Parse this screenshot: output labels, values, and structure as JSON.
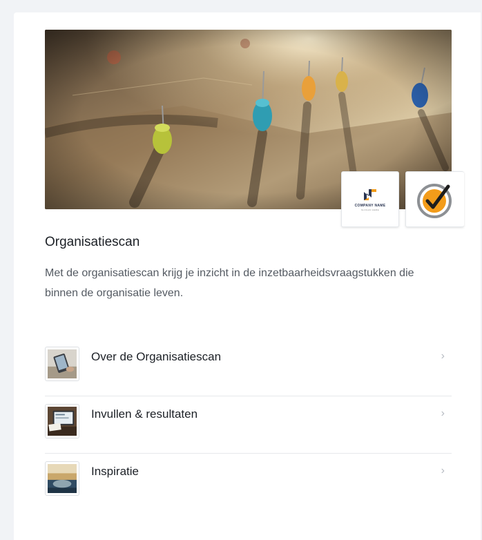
{
  "card": {
    "title": "Organisatiescan",
    "description": "Met de organisatiescan krijg je inzicht in de inzetbaarheidsvraagstukken die binnen de organisatie leven.",
    "hero_image": "map-with-push-pins",
    "badges": [
      {
        "icon": "company-name-logo",
        "text": "COMPANY NAME",
        "sub": "SLOGAN HERE"
      },
      {
        "icon": "orange-checkmark-icon"
      }
    ]
  },
  "menu": {
    "items": [
      {
        "label": "Over de Organisatiescan",
        "icon": "tablet-thumbnail",
        "chevron": "›"
      },
      {
        "label": "Invullen & resultaten",
        "icon": "laptop-thumbnail",
        "chevron": "›"
      },
      {
        "label": "Inspiratie",
        "icon": "landscape-thumbnail",
        "chevron": "›"
      }
    ]
  },
  "colors": {
    "background": "#f1f3f6",
    "card": "#ffffff",
    "accent_orange": "#f39c1a",
    "logo_navy": "#2a3552"
  }
}
